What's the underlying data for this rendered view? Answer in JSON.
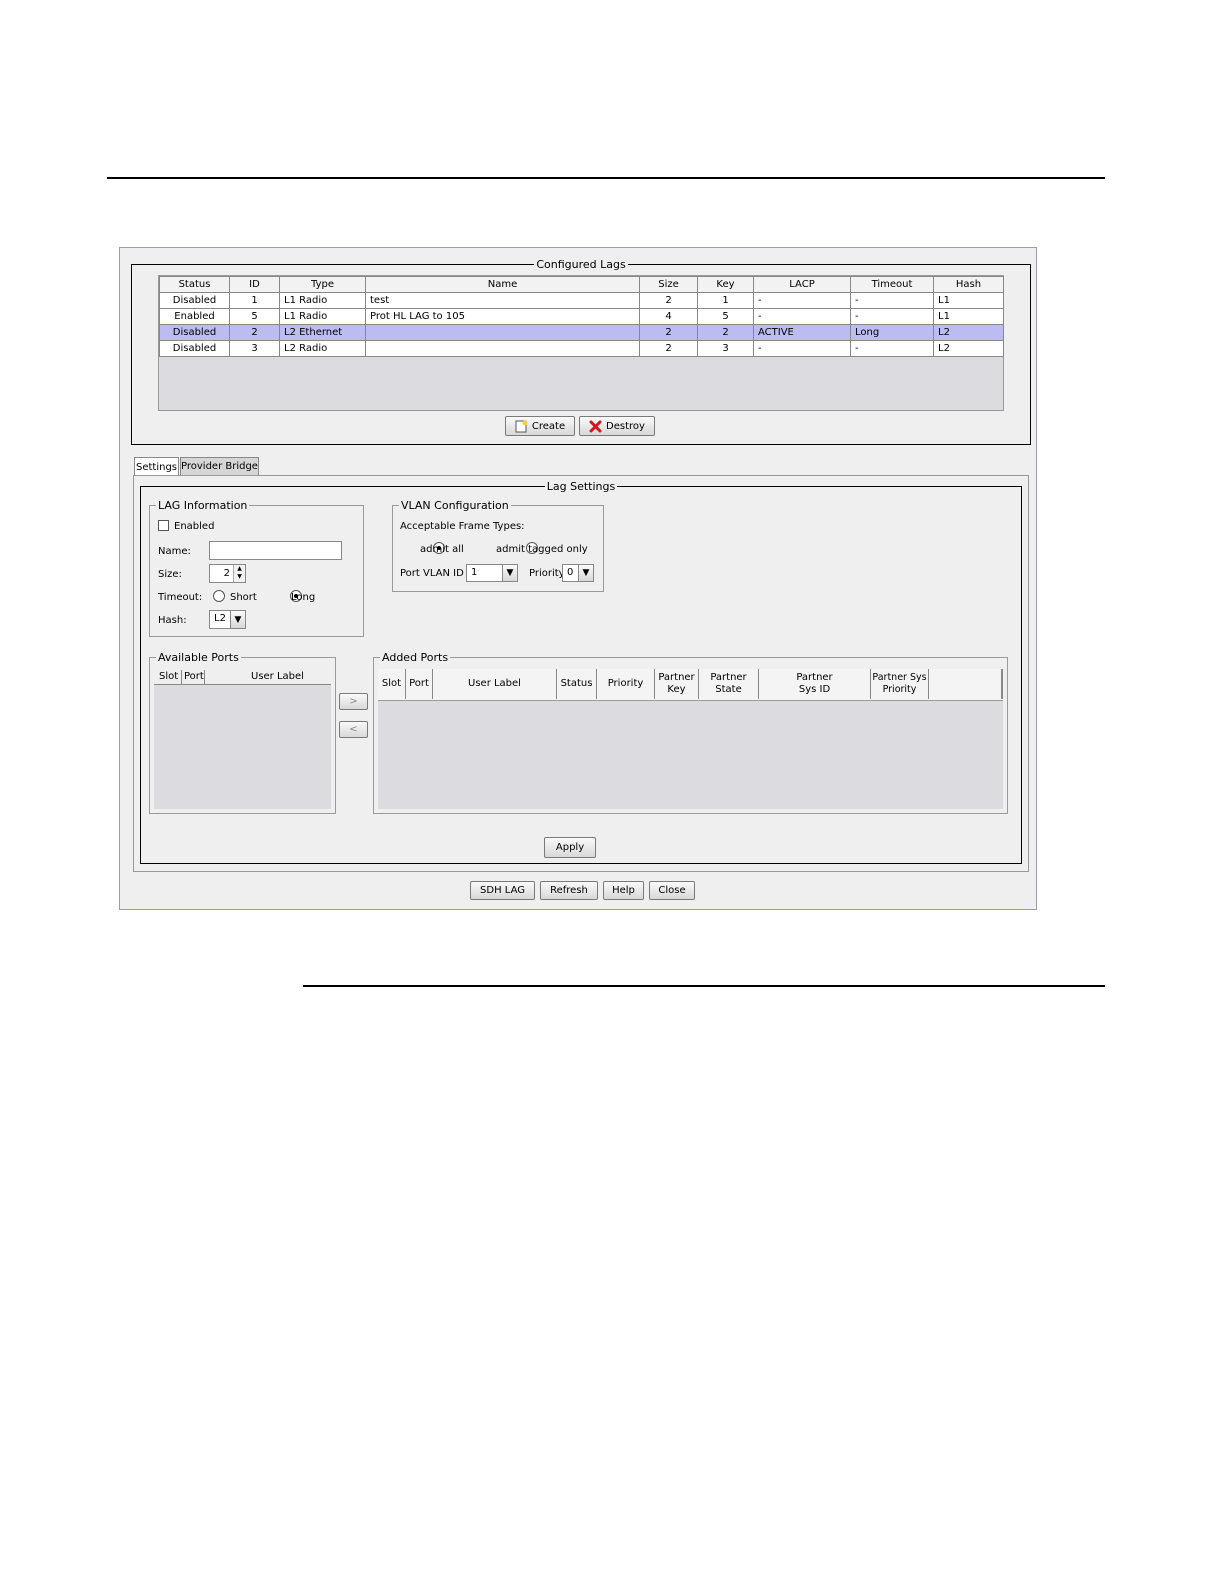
{
  "window": {
    "configured_lags": {
      "title": "Configured Lags",
      "columns": [
        "Status",
        "ID",
        "Type",
        "Name",
        "Size",
        "Key",
        "LACP",
        "Timeout",
        "Hash"
      ],
      "rows": [
        {
          "status": "Disabled",
          "id": "1",
          "type": "L1 Radio",
          "name": "test",
          "size": "2",
          "key": "1",
          "lacp": "-",
          "timeout": "-",
          "hash": "L1"
        },
        {
          "status": "Enabled",
          "id": "5",
          "type": "L1 Radio",
          "name": "Prot HL LAG to 105",
          "size": "4",
          "key": "5",
          "lacp": "-",
          "timeout": "-",
          "hash": "L1"
        },
        {
          "status": "Disabled",
          "id": "2",
          "type": "L2 Ethernet",
          "name": "",
          "size": "2",
          "key": "2",
          "lacp": "ACTIVE",
          "timeout": "Long",
          "hash": "L2",
          "selected": true
        },
        {
          "status": "Disabled",
          "id": "3",
          "type": "L2 Radio",
          "name": "",
          "size": "2",
          "key": "3",
          "lacp": "-",
          "timeout": "-",
          "hash": "L2"
        }
      ],
      "create_label": "Create",
      "destroy_label": "Destroy"
    },
    "tabs": [
      {
        "label": "Settings",
        "active": true
      },
      {
        "label": "Provider Bridge",
        "active": false
      }
    ],
    "lag_settings": {
      "title": "Lag Settings",
      "lag_info": {
        "title": "LAG Information",
        "enabled_label": "Enabled",
        "enabled": false,
        "name_label": "Name:",
        "name_value": "",
        "size_label": "Size:",
        "size_value": "2",
        "timeout_label": "Timeout:",
        "timeout_short": "Short",
        "timeout_long": "Long",
        "timeout_selected": "Long",
        "hash_label": "Hash:",
        "hash_value": "L2"
      },
      "vlan": {
        "title": "VLAN Configuration",
        "frame_types_label": "Acceptable Frame Types:",
        "admit_all": "admit all",
        "admit_tagged": "admit tagged only",
        "selected": "admit all",
        "port_vlan_label": "Port VLAN ID",
        "port_vlan_value": "1",
        "priority_label": "Priority",
        "priority_value": "0"
      },
      "available_ports": {
        "title": "Available Ports",
        "columns": [
          "Slot",
          "Port",
          "User Label"
        ]
      },
      "move_right": ">",
      "move_left": "<",
      "added_ports": {
        "title": "Added Ports",
        "columns": [
          "Slot",
          "Port",
          "User Label",
          "Status",
          "Priority",
          "Partner Key",
          "Partner State",
          "Partner Sys ID",
          "Partner Sys Priority"
        ]
      },
      "apply_label": "Apply"
    },
    "footer": {
      "sdh_lag": "SDH LAG",
      "refresh": "Refresh",
      "help": "Help",
      "close": "Close"
    }
  }
}
